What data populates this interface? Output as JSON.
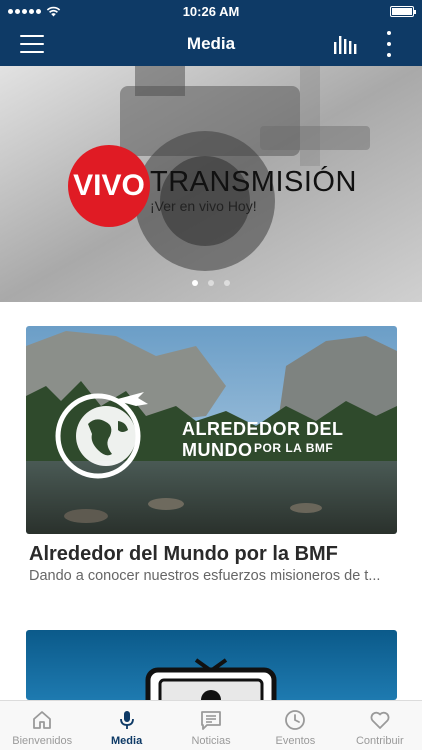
{
  "status_bar": {
    "time": "10:26 AM"
  },
  "nav": {
    "title": "Media"
  },
  "hero": {
    "badge": "VIVO",
    "title": "TRANSMISIÓN",
    "subtitle": "¡Ver en vivo Hoy!",
    "slide_count": 3,
    "active_slide": 1
  },
  "cards": [
    {
      "image_title_line1": "ALREDEDOR DEL MUNDO",
      "image_title_line2": "POR LA BMF",
      "title": "Alrededor del Mundo por la BMF",
      "description": "Dando a conocer nuestros esfuerzos misioneros de t..."
    }
  ],
  "tabs": [
    {
      "label": "Bienvenidos",
      "icon": "home-icon"
    },
    {
      "label": "Media",
      "icon": "microphone-icon",
      "active": true
    },
    {
      "label": "Noticias",
      "icon": "news-icon"
    },
    {
      "label": "Eventos",
      "icon": "clock-icon"
    },
    {
      "label": "Contribuir",
      "icon": "heart-icon"
    }
  ],
  "colors": {
    "nav_bg": "#0e3a66",
    "live_red": "#e01b24",
    "active_tab": "#0e3a66",
    "inactive_tab": "#9a9a9a"
  }
}
